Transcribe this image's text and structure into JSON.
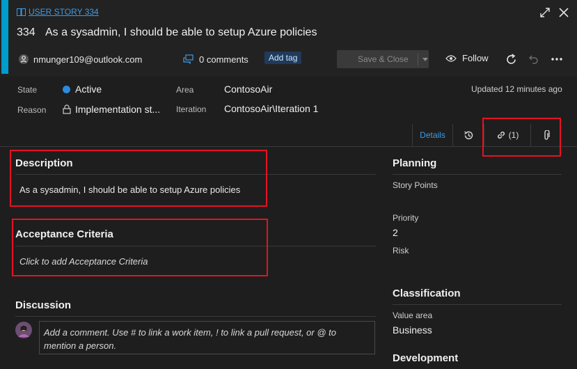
{
  "header": {
    "work_item_type": "USER STORY 334",
    "id": "334",
    "title": "As a sysadmin, I should be able to setup Azure policies",
    "assigned_to": "nmunger109@outlook.com",
    "comments": "0 comments",
    "add_tag": "Add tag",
    "save_close": "Save & Close",
    "follow": "Follow",
    "updated": "Updated 12 minutes ago"
  },
  "fields": {
    "state_label": "State",
    "state_value": "Active",
    "reason_label": "Reason",
    "reason_value": "Implementation st...",
    "area_label": "Area",
    "area_value": "ContosoAir",
    "iteration_label": "Iteration",
    "iteration_value": "ContosoAir\\Iteration 1"
  },
  "tabs": {
    "details": "Details",
    "links": "(1)"
  },
  "main": {
    "description_heading": "Description",
    "description_text": "As a sysadmin, I should be able to setup Azure policies",
    "acceptance_heading": "Acceptance Criteria",
    "acceptance_placeholder": "Click to add Acceptance Criteria",
    "discussion_heading": "Discussion",
    "comment_placeholder": "Add a comment. Use # to link a work item, ! to link a pull request, or @ to mention a person."
  },
  "side": {
    "planning_heading": "Planning",
    "story_points_label": "Story Points",
    "priority_label": "Priority",
    "priority_value": "2",
    "risk_label": "Risk",
    "classification_heading": "Classification",
    "value_area_label": "Value area",
    "value_area_value": "Business",
    "development_heading": "Development"
  },
  "colors": {
    "accent": "#009ccc",
    "link": "#3b9ce8",
    "state_active": "#2b8cde",
    "highlight": "#e81123"
  },
  "icons": [
    "book-icon",
    "expand-icon",
    "close-icon",
    "user-icon",
    "comment-icon",
    "eye-icon",
    "refresh-icon",
    "undo-icon",
    "more-icon",
    "lock-icon",
    "history-icon",
    "link-icon",
    "attachment-icon",
    "avatar"
  ]
}
